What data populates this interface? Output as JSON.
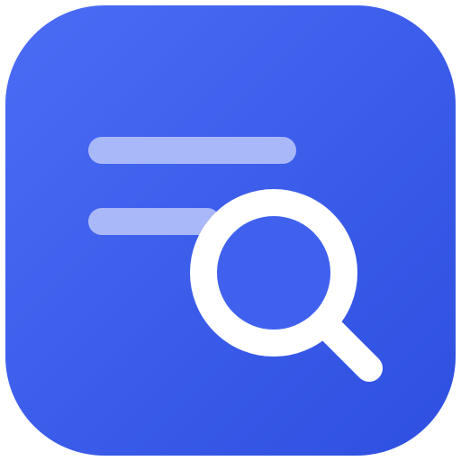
{
  "app_icon": {
    "icon_name": "list-search-icon",
    "colors": {
      "background_start": "#4A6CF5",
      "background_end": "#2E4FE0",
      "list_lines": "#A9B8F8",
      "magnifier": "#FFFFFF"
    },
    "list_line_count": 2
  }
}
